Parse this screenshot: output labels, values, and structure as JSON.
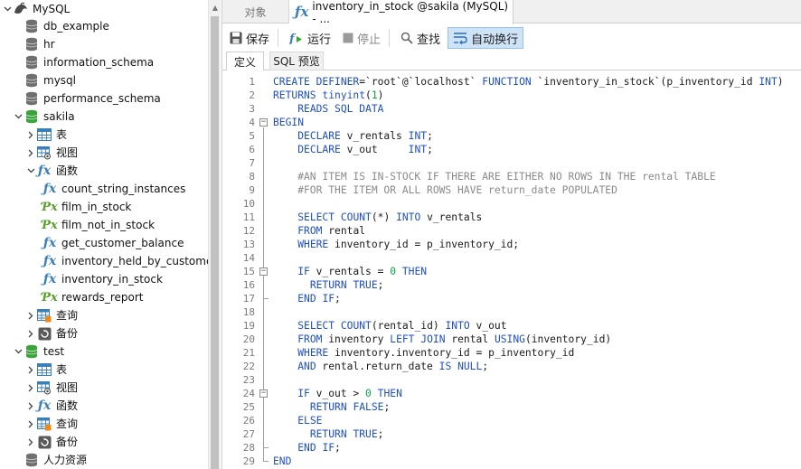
{
  "sidebar": {
    "connection": "MySQL",
    "databases": [
      "db_example",
      "hr",
      "information_schema",
      "mysql",
      "performance_schema"
    ],
    "sakila": {
      "name": "sakila",
      "tables": "表",
      "views": "视图",
      "functions": "函数",
      "function_items": [
        "count_string_instances",
        "film_in_stock",
        "film_not_in_stock",
        "get_customer_balance",
        "inventory_held_by_custome",
        "inventory_in_stock",
        "rewards_report"
      ],
      "queries": "查询",
      "backups": "备份"
    },
    "test": {
      "name": "test",
      "tables": "表",
      "views": "视图",
      "functions": "函数",
      "queries": "查询",
      "backups": "备份"
    },
    "hr_resources": "人力资源"
  },
  "tabs": {
    "objects": "对象",
    "function_tab": "inventory_in_stock @sakila (MySQL) - ..."
  },
  "toolbar": {
    "save": "保存",
    "run": "运行",
    "stop": "停止",
    "find": "查找",
    "wrap": "自动换行"
  },
  "subtabs": {
    "definition": "定义",
    "sql_preview": "SQL 预览"
  },
  "editor": {
    "lines": [
      "CREATE DEFINER=`root`@`localhost` FUNCTION `inventory_in_stock`(p_inventory_id INT)",
      "RETURNS tinyint(1)",
      "    READS SQL DATA",
      "BEGIN",
      "    DECLARE v_rentals INT;",
      "    DECLARE v_out     INT;",
      "",
      "    #AN ITEM IS IN-STOCK IF THERE ARE EITHER NO ROWS IN THE rental TABLE",
      "    #FOR THE ITEM OR ALL ROWS HAVE return_date POPULATED",
      "",
      "    SELECT COUNT(*) INTO v_rentals",
      "    FROM rental",
      "    WHERE inventory_id = p_inventory_id;",
      "",
      "    IF v_rentals = 0 THEN",
      "      RETURN TRUE;",
      "    END IF;",
      "",
      "    SELECT COUNT(rental_id) INTO v_out",
      "    FROM inventory LEFT JOIN rental USING(inventory_id)",
      "    WHERE inventory.inventory_id = p_inventory_id",
      "    AND rental.return_date IS NULL;",
      "",
      "    IF v_out > 0 THEN",
      "      RETURN FALSE;",
      "    ELSE",
      "      RETURN TRUE;",
      "    END IF;",
      "END"
    ]
  },
  "colors": {
    "keyword": "#1f4fc4",
    "comment": "#8a8a8a",
    "number": "#0aa046",
    "fx_blue": "#3b7fb8",
    "fx_green": "#5aa02c",
    "db_active_green": "#3aa43a"
  }
}
